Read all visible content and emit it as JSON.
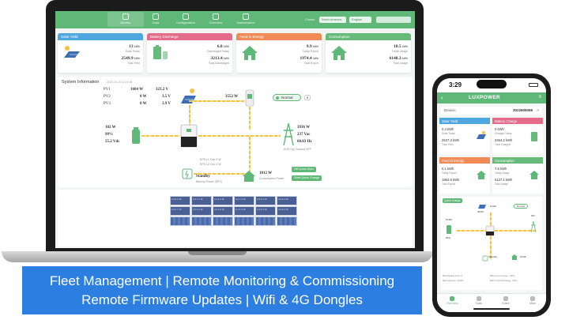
{
  "desktop": {
    "nav": [
      {
        "label": "Monitor"
      },
      {
        "label": "Data"
      },
      {
        "label": "Configuration"
      },
      {
        "label": "Overview"
      },
      {
        "label": "Maintenance"
      }
    ],
    "header": {
      "cluster_label": "Cluster",
      "cluster_value": "North America",
      "language_value": "English"
    },
    "cards": {
      "solar": {
        "title": "Solar Yield",
        "today_value": "13",
        "today_unit": "kWh",
        "today_label": "Solar Today",
        "total_value": "2549.9",
        "total_unit": "kWh",
        "total_label": "Total Yield"
      },
      "battery": {
        "title": "Battery Discharge",
        "today_value": "6.8",
        "today_unit": "kWh",
        "today_label": "Discharged Today",
        "total_value": "3213.4",
        "total_unit": "kWh",
        "total_label": "Total Discharged"
      },
      "grid": {
        "title": "Feed-in Energy",
        "today_value": "9.9",
        "today_unit": "kWh",
        "today_label": "Today Export",
        "total_value": "1974.4",
        "total_unit": "kWh",
        "total_label": "Total Export"
      },
      "consumption": {
        "title": "Consumption",
        "today_value": "18.5",
        "today_unit": "kWh",
        "today_label": "Today Usage",
        "total_value": "6148.3",
        "total_unit": "kWh",
        "total_label": "Total Usage"
      }
    },
    "system": {
      "title": "System Information",
      "timestamp": "2023-10-10 12:27:08",
      "pv_rows": [
        {
          "name": "PV1",
          "power": "1604 W",
          "voltage": "323.2 V"
        },
        {
          "name": "PV2",
          "power": "0 W",
          "voltage": "3.5 V"
        },
        {
          "name": "PV3",
          "power": "0 W",
          "voltage": "3.9 V"
        }
      ],
      "pv_power": "3552 W",
      "mode": "Normal",
      "mode_num": "0",
      "battery_power": "102 W",
      "battery_soc": "99%",
      "battery_voltage": "55.2 Vdc",
      "grid_power": "3936 W",
      "grid_voltage": "237 Vac",
      "grid_freq": "60.03 Hz",
      "grid_note": "AGS Dry Contact OFF",
      "eps_lines": [
        "EPS L1 Out: 0 W",
        "EPS L2 Out: 0 W"
      ],
      "eps_status": "Standby",
      "eps_label": "Backup Power (EPS)",
      "consumption_power": "1012 W",
      "consumption_label": "Consumption Power",
      "btn_quick_start": "Off Quick Start",
      "btn_quick_charge": "Start Quick Charge"
    },
    "panel_layout": {
      "cells": [
        "4.2 3.4 10",
        "4.4 1.7 10",
        "4.1 3.4 10",
        "4.2 1.0 10",
        "4.3 3.2 10",
        "4.4 3.3 10"
      ]
    }
  },
  "banner": {
    "line1": "Fleet Management | Remote Monitoring & Commissioning",
    "line2": "Remote Firmware Updates | Wifi & 4G Dongles"
  },
  "phone": {
    "time": "3:29",
    "logo": "LUXPOWER",
    "device_label": "Device:",
    "device_value": "3022605069",
    "cards": [
      {
        "title": "Solar Yield",
        "v1": "0.4 kWh",
        "l1": "Solar Today",
        "v2": "2537.3 kWh",
        "l2": "Total Yield"
      },
      {
        "title": "Battery Charge",
        "v1": "0 kWh",
        "l1": "Charged Today",
        "v2": "3464.2 kWh",
        "l2": "Total Charged"
      },
      {
        "title": "Feed in Energy",
        "v1": "0.1 kWh",
        "l1": "Today Export",
        "v2": "1964.6 kWh",
        "l2": "Total Export"
      },
      {
        "title": "Consumption",
        "v1": "7.5 kWh",
        "l1": "Today Usage",
        "v2": "6137.1 kWh",
        "l2": "Total Usage"
      }
    ],
    "flow": {
      "tag": "Quick charge",
      "pv1": "301W",
      "pv2": "121W",
      "normal": "Normal",
      "battery": "574W",
      "grid": "0W",
      "soc": "83%",
      "eps": "Standby",
      "cons": "972W",
      "bat_label1": "Batt Parallel Num:",
      "bat_val1": "8",
      "bat_label2": "Batt Capacity:",
      "bat_val2": "20345...",
      "bms_label1": "BMS Limit Charge:",
      "bms_val1": "728 A",
      "bms_label2": "BMS Limit Discharge:",
      "bms_val2": "728 A"
    },
    "tabs": [
      "Overview",
      "Data",
      "Event",
      "Mine"
    ]
  },
  "colors": {
    "brand_green": "#5fb878",
    "solar_blue": "#4fa7e0",
    "battery_pink": "#e46b8a",
    "grid_orange": "#f08a57",
    "consumption_green": "#66bb7a",
    "banner_blue": "#2c7fe0",
    "flow_yellow": "#f5c242"
  }
}
